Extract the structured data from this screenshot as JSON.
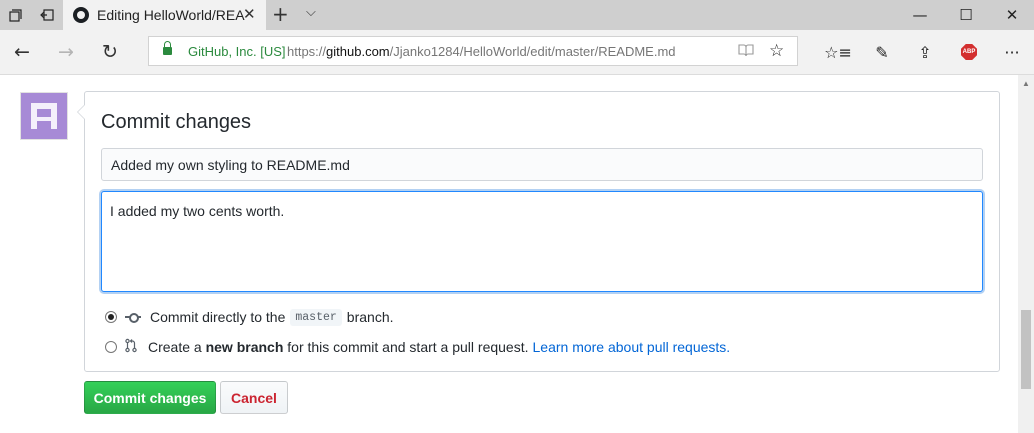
{
  "browser": {
    "tab": {
      "title": "Editing HelloWorld/REA",
      "close": "✕"
    },
    "tab_controls": {
      "new_tab": "+",
      "tab_list": "⌵"
    },
    "window": {
      "minimize": "—",
      "maximize": "☐",
      "close": "✕"
    },
    "nav": {
      "back": "←",
      "forward": "→",
      "refresh": "↻"
    },
    "address": {
      "site_identity": "GitHub, Inc. [US]",
      "url_scheme": "https://",
      "url_host": "github.com",
      "url_path": "/Jjanko1284/HelloWorld/edit/master/README.md"
    },
    "toolbar": {
      "favorites": "☆≡",
      "notes": "✎",
      "share": "⇪",
      "adblock": "ABP",
      "more": "···"
    }
  },
  "commit_form": {
    "heading": "Commit changes",
    "summary_value": "Added my own styling to README.md",
    "description_value": "I added my two cents worth.",
    "option_direct": {
      "text_before": "Commit directly to the",
      "branch": "master",
      "text_after": "branch."
    },
    "option_new_branch": {
      "text_before": "Create a",
      "bold": "new branch",
      "text_after": "for this commit and start a pull request.",
      "link": "Learn more about pull requests."
    },
    "commit_button": "Commit changes",
    "cancel_button": "Cancel"
  },
  "colors": {
    "primary_button": "#28a745",
    "cancel_text": "#cb2431",
    "link": "#0366d6",
    "secure_green": "#2b8a3e"
  },
  "icons": [
    "tab-actions-icon",
    "set-aside-tabs-icon",
    "github-icon",
    "lock-icon",
    "reading-view-icon",
    "favorite-star-icon",
    "commit-icon",
    "git-pull-request-icon",
    "avatar-identicon"
  ]
}
